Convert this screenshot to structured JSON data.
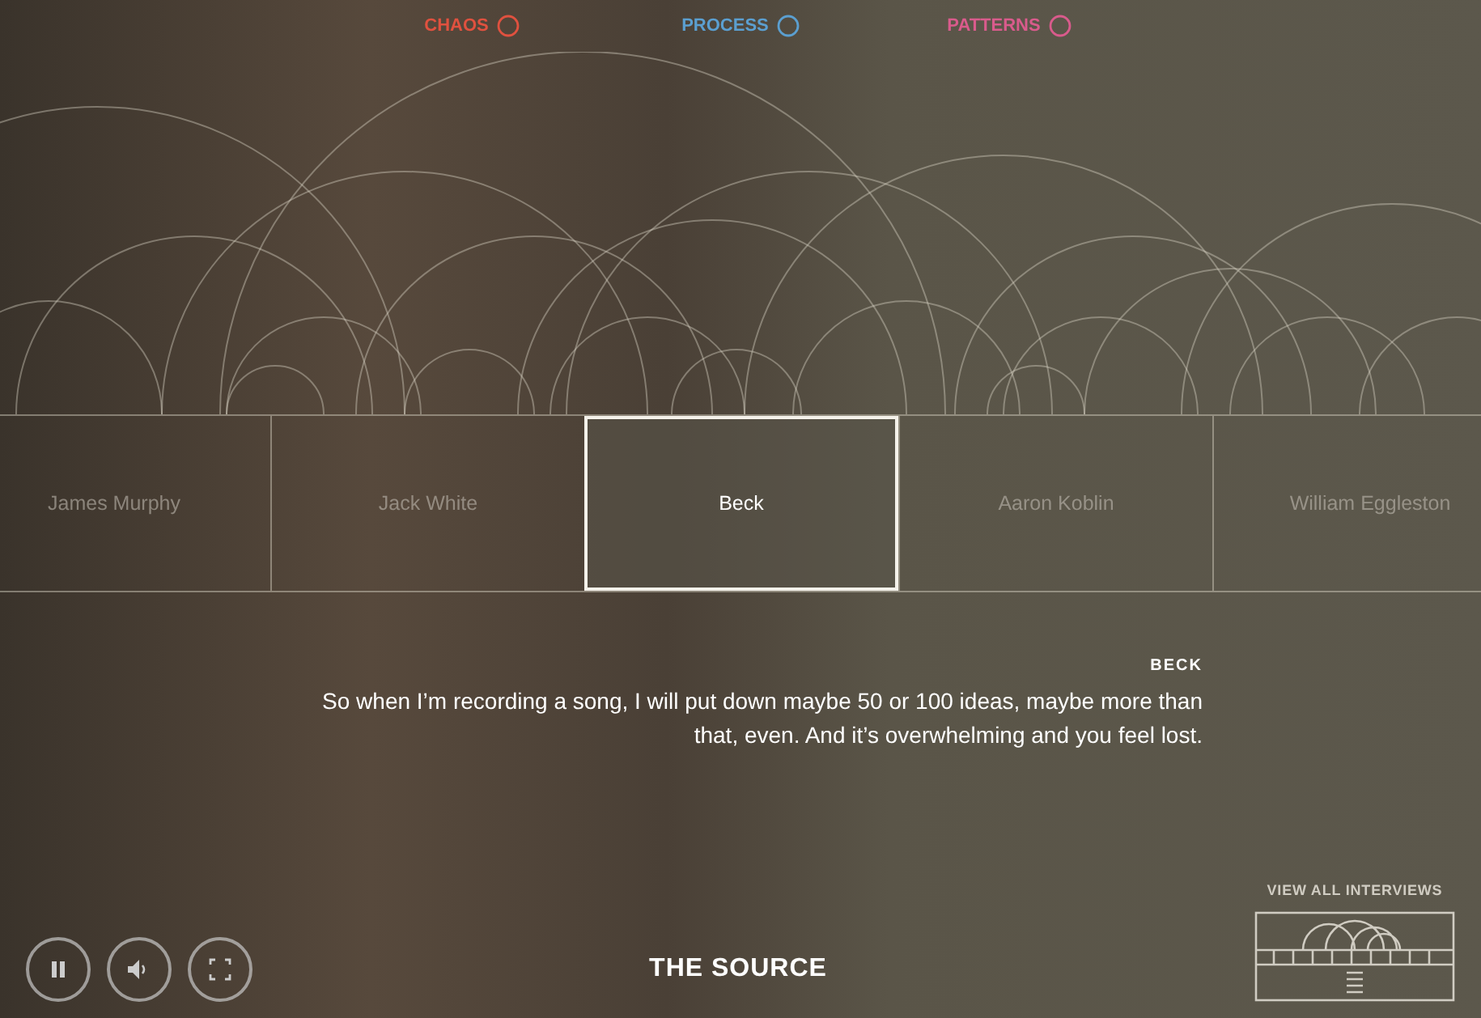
{
  "categories": [
    {
      "label": "CHAOS",
      "color": "#e0513f"
    },
    {
      "label": "PROCESS",
      "color": "#5b9fd0"
    },
    {
      "label": "PATTERNS",
      "color": "#d95b8c"
    }
  ],
  "interviews": [
    {
      "name": "James Murphy",
      "selected": false
    },
    {
      "name": "Jack White",
      "selected": false
    },
    {
      "name": "Beck",
      "selected": true
    },
    {
      "name": "Aaron Koblin",
      "selected": false
    },
    {
      "name": "William Eggleston",
      "selected": false
    }
  ],
  "quote": {
    "speaker": "BECK",
    "text": "So when I’m recording a song, I will put down maybe 50 or 100 ideas, maybe more than that, even. And it’s overwhelming and you feel lost."
  },
  "player": {
    "title": "THE SOURCE",
    "playing": true
  },
  "view_all": {
    "label": "VIEW ALL INTERVIEWS"
  }
}
